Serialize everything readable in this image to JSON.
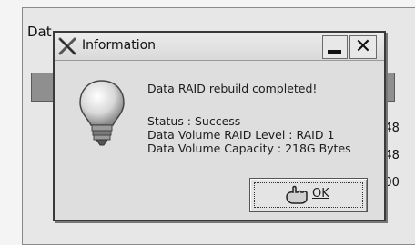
{
  "background_window": {
    "title_fragment": "Dat",
    "times": [
      ":48",
      ":48",
      ":00"
    ]
  },
  "dialog": {
    "title": "Information",
    "headline": "Data RAID rebuild completed!",
    "status_lines": [
      "Status : Success",
      "Data Volume RAID Level : RAID 1",
      "Data Volume Capacity : 218G Bytes"
    ],
    "ok_label": "OK",
    "close_glyph": "✕",
    "icons": {
      "app": "x-app-icon",
      "info": "lightbulb-icon",
      "ok": "hand-pointer-icon"
    }
  }
}
